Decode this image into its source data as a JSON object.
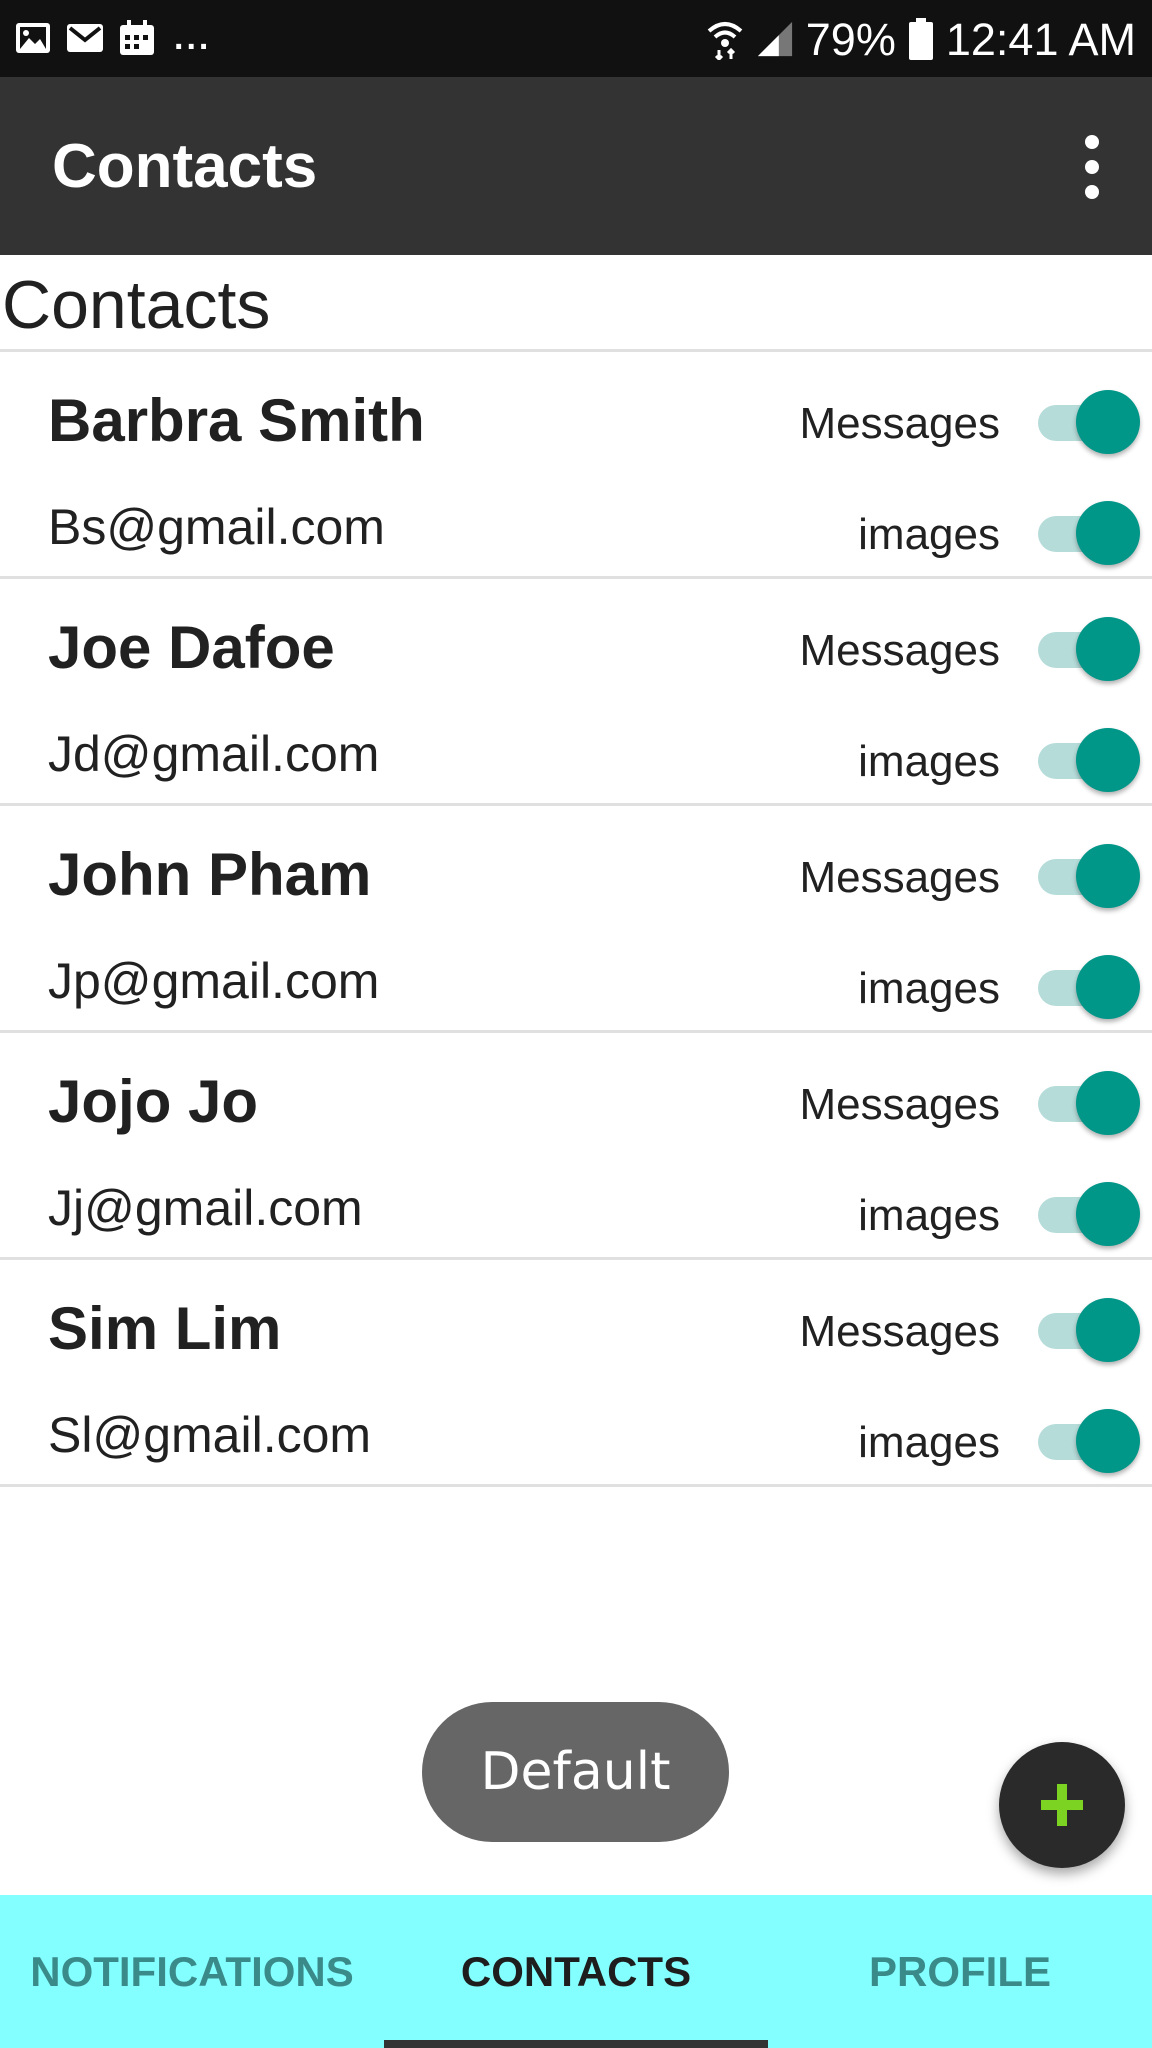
{
  "status_bar": {
    "notification_icons": [
      "image-icon",
      "mail-icon",
      "calendar-icon"
    ],
    "overflow_indicator": "...",
    "battery_percent": "79%",
    "time": "12:41 AM",
    "system_icons": [
      "wifi-icon",
      "signal-icon",
      "battery-icon"
    ]
  },
  "app_bar": {
    "title": "Contacts",
    "menu_icon": "more-vert-icon"
  },
  "section": {
    "title": "Contacts"
  },
  "contacts": [
    {
      "name": "Barbra Smith",
      "email": "Bs@gmail.com",
      "messages_label": "Messages",
      "images_label": "images",
      "messages_on": true,
      "images_on": true
    },
    {
      "name": "Joe Dafoe",
      "email": "Jd@gmail.com",
      "messages_label": "Messages",
      "images_label": "images",
      "messages_on": true,
      "images_on": true
    },
    {
      "name": "John Pham",
      "email": "Jp@gmail.com",
      "messages_label": "Messages",
      "images_label": "images",
      "messages_on": true,
      "images_on": true
    },
    {
      "name": "Jojo Jo",
      "email": "Jj@gmail.com",
      "messages_label": "Messages",
      "images_label": "images",
      "messages_on": true,
      "images_on": true
    },
    {
      "name": "Sim Lim",
      "email": "Sl@gmail.com",
      "messages_label": "Messages",
      "images_label": "images",
      "messages_on": true,
      "images_on": true
    }
  ],
  "toast": {
    "text": "Default"
  },
  "fab": {
    "icon": "plus-icon"
  },
  "tabs": [
    {
      "label": "NOTIFICATIONS",
      "selected": false
    },
    {
      "label": "CONTACTS",
      "selected": true
    },
    {
      "label": "PROFILE",
      "selected": false
    }
  ],
  "colors": {
    "status_bar": "#111111",
    "app_bar": "#333333",
    "switch_thumb": "#009688",
    "switch_track": "#b5dcd9",
    "tab_bar": "#84ffff",
    "fab_plus": "#7cd321"
  }
}
